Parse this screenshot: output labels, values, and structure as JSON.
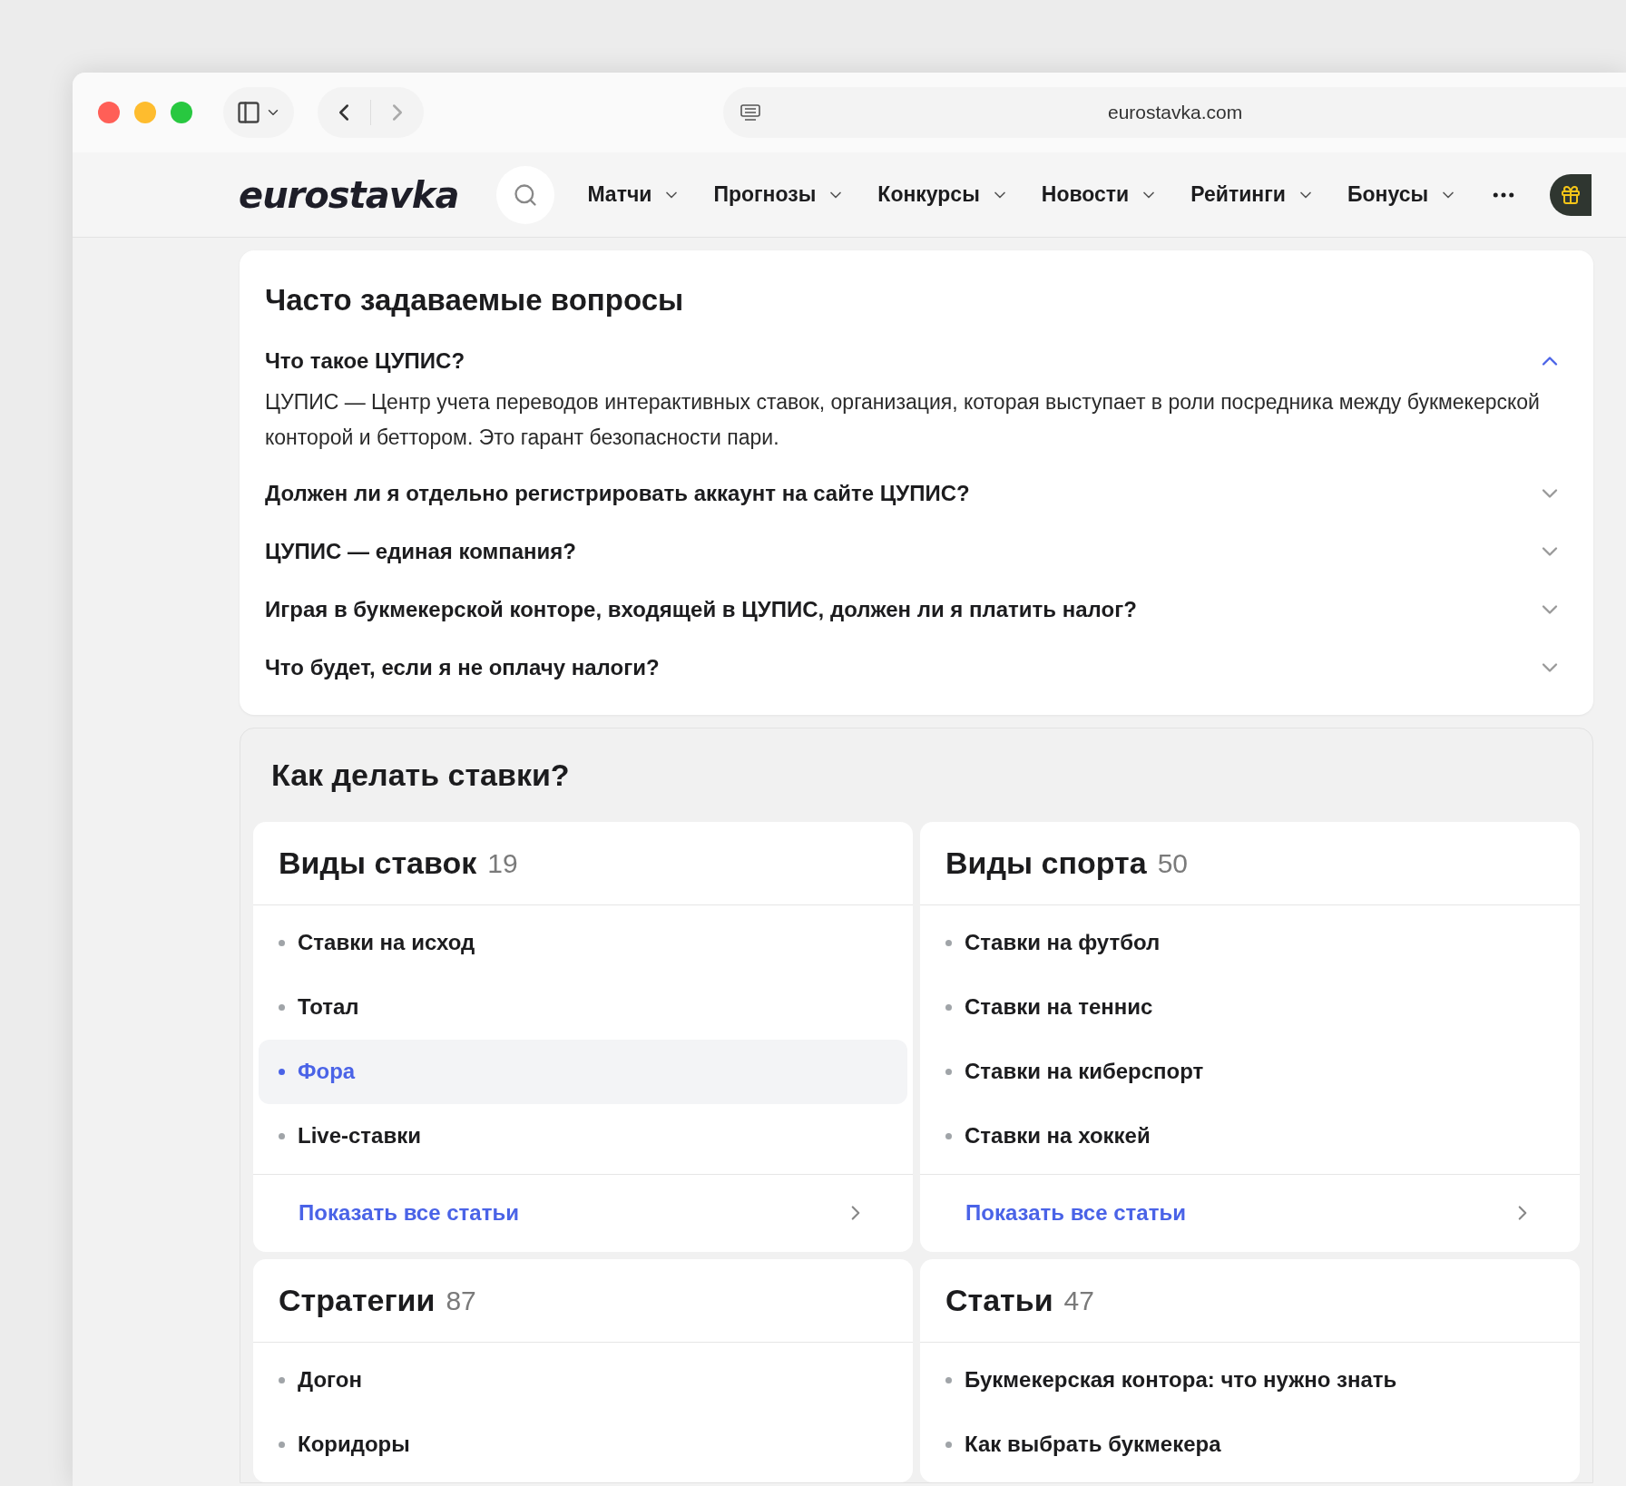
{
  "browser": {
    "url": "eurostavka.com"
  },
  "nav": {
    "logo": "eurostavka",
    "items": [
      {
        "label": "Матчи"
      },
      {
        "label": "Прогнозы"
      },
      {
        "label": "Конкурсы"
      },
      {
        "label": "Новости"
      },
      {
        "label": "Рейтинги"
      },
      {
        "label": "Бонусы"
      }
    ]
  },
  "faq": {
    "title": "Часто задаваемые вопросы",
    "items": [
      {
        "question": "Что такое ЦУПИС?",
        "expanded": true,
        "answer": "ЦУПИС — Центр учета переводов интерактивных ставок, организация, которая выступает в роли посредника между букмекерской конторой и беттором. Это гарант безопасности пари."
      },
      {
        "question": "Должен ли я отдельно регистрировать аккаунт на сайте ЦУПИС?",
        "expanded": false
      },
      {
        "question": "ЦУПИС — единая компания?",
        "expanded": false
      },
      {
        "question": "Играя в букмекерской конторе, входящей в ЦУПИС, должен ли я платить налог?",
        "expanded": false
      },
      {
        "question": "Что будет, если я не оплачу налоги?",
        "expanded": false
      }
    ]
  },
  "howto": {
    "title": "Как делать ставки?",
    "categories": [
      {
        "title": "Виды ставок",
        "count": "19",
        "items": [
          {
            "label": "Ставки на исход",
            "selected": false
          },
          {
            "label": "Тотал",
            "selected": false
          },
          {
            "label": "Фора",
            "selected": true
          },
          {
            "label": "Live-ставки",
            "selected": false
          }
        ],
        "link": "Показать все статьи"
      },
      {
        "title": "Виды спорта",
        "count": "50",
        "items": [
          {
            "label": "Ставки на футбол",
            "selected": false
          },
          {
            "label": "Ставки на теннис",
            "selected": false
          },
          {
            "label": "Ставки на киберспорт",
            "selected": false
          },
          {
            "label": "Ставки на хоккей",
            "selected": false
          }
        ],
        "link": "Показать все статьи"
      },
      {
        "title": "Стратегии",
        "count": "87",
        "items": [
          {
            "label": "Догон",
            "selected": false
          },
          {
            "label": "Коридоры",
            "selected": false
          }
        ]
      },
      {
        "title": "Статьи",
        "count": "47",
        "items": [
          {
            "label": "Букмекерская контора: что нужно знать",
            "selected": false
          },
          {
            "label": "Как выбрать букмекера",
            "selected": false
          }
        ]
      }
    ]
  }
}
